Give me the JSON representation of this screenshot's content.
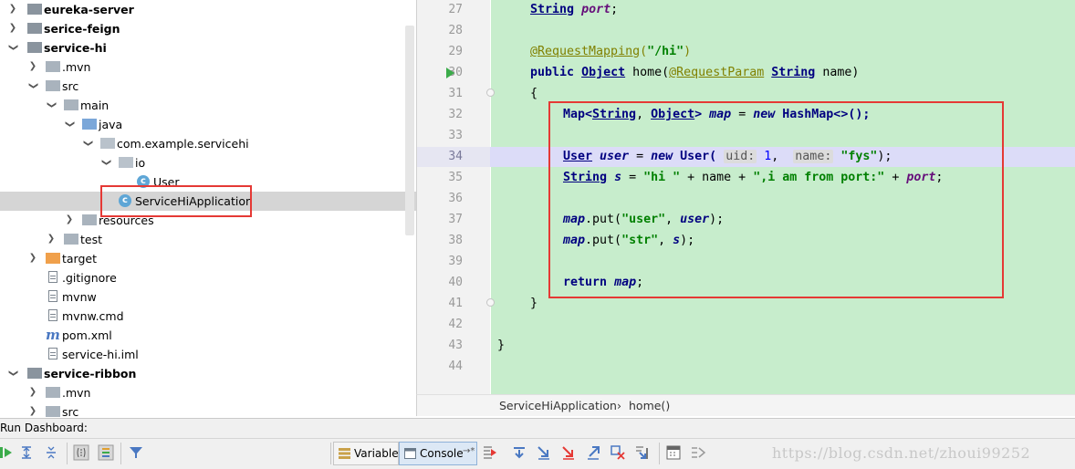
{
  "project_tree": {
    "items": [
      {
        "label": "eureka-server",
        "bold": true
      },
      {
        "label": "serice-feign",
        "bold": true
      },
      {
        "label": "service-hi",
        "bold": true
      },
      {
        "label": ".mvn",
        "bold": false
      },
      {
        "label": "src",
        "bold": false
      },
      {
        "label": "main",
        "bold": false
      },
      {
        "label": "java",
        "bold": false
      },
      {
        "label": "com.example.servicehi",
        "bold": false
      },
      {
        "label": "io",
        "bold": false
      },
      {
        "label": "User",
        "bold": false
      },
      {
        "label": "ServiceHiApplication",
        "bold": false
      },
      {
        "label": "resources",
        "bold": false
      },
      {
        "label": "test",
        "bold": false
      },
      {
        "label": "target",
        "bold": false
      },
      {
        "label": ".gitignore",
        "bold": false
      },
      {
        "label": "mvnw",
        "bold": false
      },
      {
        "label": "mvnw.cmd",
        "bold": false
      },
      {
        "label": "pom.xml",
        "bold": false
      },
      {
        "label": "service-hi.iml",
        "bold": false
      },
      {
        "label": "service-ribbon",
        "bold": true
      },
      {
        "label": ".mvn",
        "bold": false
      },
      {
        "label": "src",
        "bold": false
      }
    ]
  },
  "editor": {
    "line_numbers": [
      "27",
      "28",
      "29",
      "30",
      "31",
      "32",
      "33",
      "34",
      "35",
      "36",
      "37",
      "38",
      "39",
      "40",
      "41",
      "42",
      "43",
      "44"
    ],
    "current_line": "34",
    "code": {
      "l27_type": "String",
      "l27_field": "port",
      "l29_ann": "@RequestMapping",
      "l29_paren_open": "(",
      "l29_str": "\"/hi\"",
      "l29_paren_close": ")",
      "l30_public": "public",
      "l30_type": "Object",
      "l30_name": "home(",
      "l30_ann": "@RequestParam",
      "l30_ptype": "String",
      "l30_pname": "name)",
      "l31_brace": "{",
      "l32_a": "Map<",
      "l32_t1": "String",
      "l32_comma": ", ",
      "l32_t2": "Object",
      "l32_gt": ">",
      "l32_var": "map",
      "l32_eq": " = ",
      "l32_new": "new",
      "l32_rest": " HashMap<>();",
      "l34_type": "User",
      "l34_var": "user",
      "l34_eq": " = ",
      "l34_new": "new",
      "l34_ctor": " User(",
      "l34_hint1": "uid:",
      "l34_num": "1",
      "l34_comma": ",",
      "l34_hint2": "name:",
      "l34_str": "\"fys\"",
      "l34_end": ");",
      "l35_type": "String",
      "l35_var": "s",
      "l35_eq": " = ",
      "l35_str1": "\"hi \"",
      "l35_plus1": " + name + ",
      "l35_str2": "\",i am from port:\"",
      "l35_plus2": " + ",
      "l35_field": "port",
      "l35_semi": ";",
      "l37_map": "map",
      "l37_put": ".put(",
      "l37_str": "\"user\"",
      "l37_comma": ", ",
      "l37_var": "user",
      "l37_end": ");",
      "l38_map": "map",
      "l38_put": ".put(",
      "l38_str": "\"str\"",
      "l38_comma": ", ",
      "l38_var": "s",
      "l38_end": ");",
      "l40_return": "return",
      "l40_var": "map",
      "l40_semi": ";",
      "l41_brace": "}",
      "l43_brace": "}"
    }
  },
  "breadcrumb": {
    "class_name": "ServiceHiApplication",
    "separator": "›",
    "method": "home()"
  },
  "run_dashboard": {
    "title": "Run Dashboard:",
    "tabs": {
      "variables": "Variables",
      "console": "Console",
      "console_suffix": "→*"
    }
  },
  "watermark": "https://blog.csdn.net/zhoui99252",
  "colors": {
    "code_background": "#c7edcc",
    "highlight_border": "#e53935",
    "caret_line": "#dcdcf8",
    "selected_row": "#d5d5d5"
  }
}
